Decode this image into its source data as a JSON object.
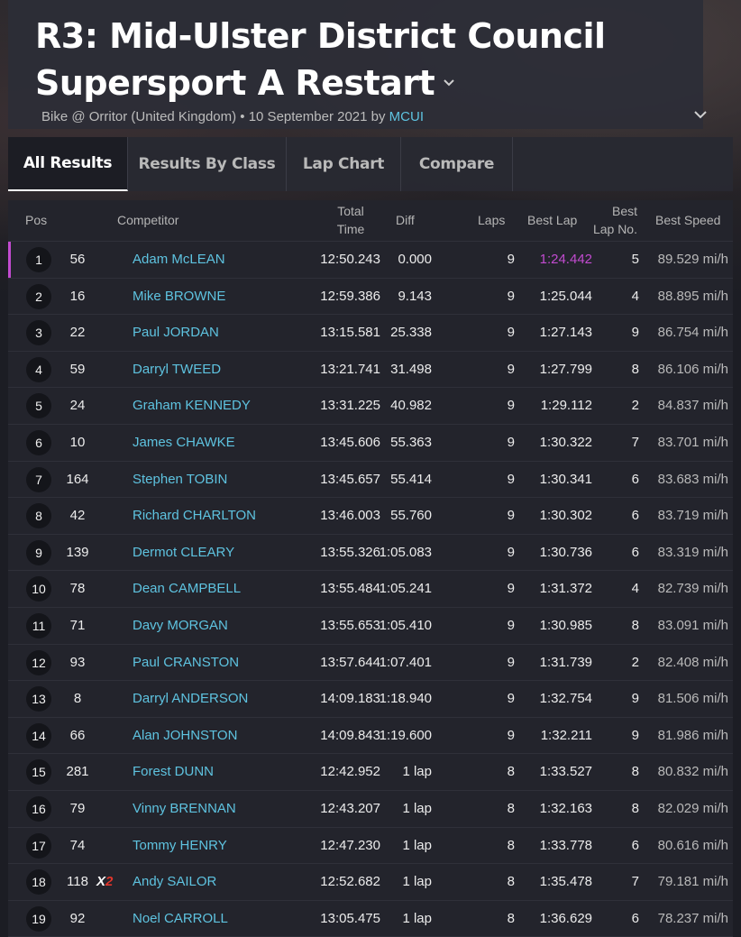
{
  "header": {
    "title": "R3: Mid-Ulster District Council Supersport A Restart",
    "subtitle_prefix": "Bike @ Orritor (United Kingdom) • 10 September 2021 by",
    "author": "MCUI"
  },
  "tabs": [
    "All Results",
    "Results By Class",
    "Lap Chart",
    "Compare"
  ],
  "active_tab": "All Results",
  "columns": {
    "pos": "Pos",
    "competitor": "Competitor",
    "total_time_1": "Total",
    "total_time_2": "Time",
    "diff": "Diff",
    "laps": "Laps",
    "best_lap": "Best Lap",
    "best_lap_no_1": "Best",
    "best_lap_no_2": "Lap No.",
    "best_speed": "Best Speed"
  },
  "rows": [
    {
      "pos": "1",
      "num": "56",
      "name": "Adam McLEAN",
      "time": "12:50.243",
      "diff": "0.000",
      "laps": "9",
      "best_lap": "1:24.442",
      "lap_no": "5",
      "speed": "89.529 mi/h"
    },
    {
      "pos": "2",
      "num": "16",
      "name": "Mike BROWNE",
      "time": "12:59.386",
      "diff": "9.143",
      "laps": "9",
      "best_lap": "1:25.044",
      "lap_no": "4",
      "speed": "88.895 mi/h"
    },
    {
      "pos": "3",
      "num": "22",
      "name": "Paul JORDAN",
      "time": "13:15.581",
      "diff": "25.338",
      "laps": "9",
      "best_lap": "1:27.143",
      "lap_no": "9",
      "speed": "86.754 mi/h"
    },
    {
      "pos": "4",
      "num": "59",
      "name": "Darryl TWEED",
      "time": "13:21.741",
      "diff": "31.498",
      "laps": "9",
      "best_lap": "1:27.799",
      "lap_no": "8",
      "speed": "86.106 mi/h"
    },
    {
      "pos": "5",
      "num": "24",
      "name": "Graham KENNEDY",
      "time": "13:31.225",
      "diff": "40.982",
      "laps": "9",
      "best_lap": "1:29.112",
      "lap_no": "2",
      "speed": "84.837 mi/h"
    },
    {
      "pos": "6",
      "num": "10",
      "name": "James CHAWKE",
      "time": "13:45.606",
      "diff": "55.363",
      "laps": "9",
      "best_lap": "1:30.322",
      "lap_no": "7",
      "speed": "83.701 mi/h"
    },
    {
      "pos": "7",
      "num": "164",
      "name": "Stephen TOBIN",
      "time": "13:45.657",
      "diff": "55.414",
      "laps": "9",
      "best_lap": "1:30.341",
      "lap_no": "6",
      "speed": "83.683 mi/h"
    },
    {
      "pos": "8",
      "num": "42",
      "name": "Richard CHARLTON",
      "time": "13:46.003",
      "diff": "55.760",
      "laps": "9",
      "best_lap": "1:30.302",
      "lap_no": "6",
      "speed": "83.719 mi/h"
    },
    {
      "pos": "9",
      "num": "139",
      "name": "Dermot CLEARY",
      "time": "13:55.326",
      "diff": "1:05.083",
      "laps": "9",
      "best_lap": "1:30.736",
      "lap_no": "6",
      "speed": "83.319 mi/h"
    },
    {
      "pos": "10",
      "num": "78",
      "name": "Dean CAMPBELL",
      "time": "13:55.484",
      "diff": "1:05.241",
      "laps": "9",
      "best_lap": "1:31.372",
      "lap_no": "4",
      "speed": "82.739 mi/h"
    },
    {
      "pos": "11",
      "num": "71",
      "name": "Davy MORGAN",
      "time": "13:55.653",
      "diff": "1:05.410",
      "laps": "9",
      "best_lap": "1:30.985",
      "lap_no": "8",
      "speed": "83.091 mi/h"
    },
    {
      "pos": "12",
      "num": "93",
      "name": "Paul CRANSTON",
      "time": "13:57.644",
      "diff": "1:07.401",
      "laps": "9",
      "best_lap": "1:31.739",
      "lap_no": "2",
      "speed": "82.408 mi/h"
    },
    {
      "pos": "13",
      "num": "8",
      "name": "Darryl ANDERSON",
      "time": "14:09.183",
      "diff": "1:18.940",
      "laps": "9",
      "best_lap": "1:32.754",
      "lap_no": "9",
      "speed": "81.506 mi/h"
    },
    {
      "pos": "14",
      "num": "66",
      "name": "Alan JOHNSTON",
      "time": "14:09.843",
      "diff": "1:19.600",
      "laps": "9",
      "best_lap": "1:32.211",
      "lap_no": "9",
      "speed": "81.986 mi/h"
    },
    {
      "pos": "15",
      "num": "281",
      "name": "Forest DUNN",
      "time": "12:42.952",
      "diff": "1 lap",
      "laps": "8",
      "best_lap": "1:33.527",
      "lap_no": "8",
      "speed": "80.832 mi/h"
    },
    {
      "pos": "16",
      "num": "79",
      "name": "Vinny BRENNAN",
      "time": "12:43.207",
      "diff": "1 lap",
      "laps": "8",
      "best_lap": "1:32.163",
      "lap_no": "8",
      "speed": "82.029 mi/h"
    },
    {
      "pos": "17",
      "num": "74",
      "name": "Tommy HENRY",
      "time": "12:47.230",
      "diff": "1 lap",
      "laps": "8",
      "best_lap": "1:33.778",
      "lap_no": "6",
      "speed": "80.616 mi/h"
    },
    {
      "pos": "18",
      "num": "118",
      "name": "Andy SAILOR",
      "time": "12:52.682",
      "diff": "1 lap",
      "laps": "8",
      "best_lap": "1:35.478",
      "lap_no": "7",
      "speed": "79.181 mi/h",
      "badge_x": "X",
      "badge_2": "2"
    },
    {
      "pos": "19",
      "num": "92",
      "name": "Noel CARROLL",
      "time": "13:05.475",
      "diff": "1 lap",
      "laps": "8",
      "best_lap": "1:36.629",
      "lap_no": "6",
      "speed": "78.237 mi/h"
    }
  ],
  "colors": {
    "link": "#5ec3e0",
    "fastest_lap": "#c24bd0",
    "leader_marker": "#c24bd0",
    "badge_two": "#e0352b"
  }
}
